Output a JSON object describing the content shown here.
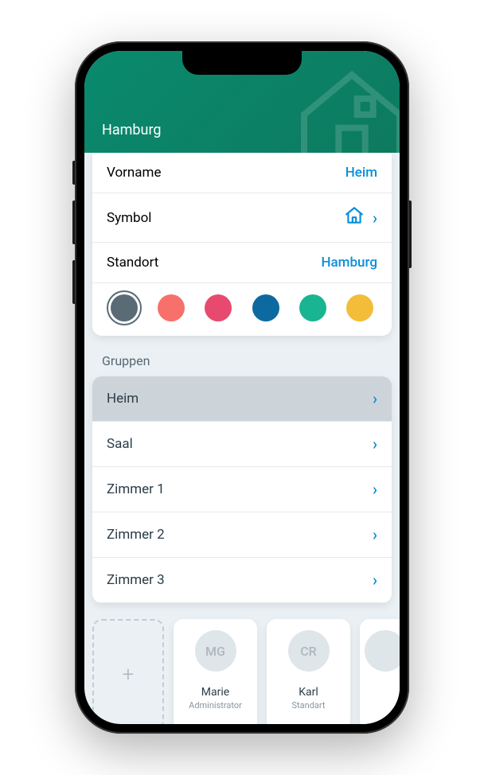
{
  "header": {
    "title": "Hamburg"
  },
  "settings": {
    "vorname": {
      "label": "Vorname",
      "value": "Heim"
    },
    "symbol": {
      "label": "Symbol"
    },
    "standort": {
      "label": "Standort",
      "value": "Hamburg"
    }
  },
  "colors": [
    {
      "hex": "#5a6b75",
      "selected": true
    },
    {
      "hex": "#f7706b",
      "selected": false
    },
    {
      "hex": "#e74a6e",
      "selected": false
    },
    {
      "hex": "#0c6aa0",
      "selected": false
    },
    {
      "hex": "#19b593",
      "selected": false
    },
    {
      "hex": "#f3bd3a",
      "selected": false
    }
  ],
  "groups": {
    "title": "Gruppen",
    "items": [
      {
        "label": "Heim",
        "active": true
      },
      {
        "label": "Saal",
        "active": false
      },
      {
        "label": "Zimmer 1",
        "active": false
      },
      {
        "label": "Zimmer 2",
        "active": false
      },
      {
        "label": "Zimmer 3",
        "active": false
      }
    ]
  },
  "users": [
    {
      "initials": "MG",
      "name": "Marie",
      "role": "Administrator"
    },
    {
      "initials": "CR",
      "name": "Karl",
      "role": "Standart"
    }
  ],
  "add_label": "+"
}
